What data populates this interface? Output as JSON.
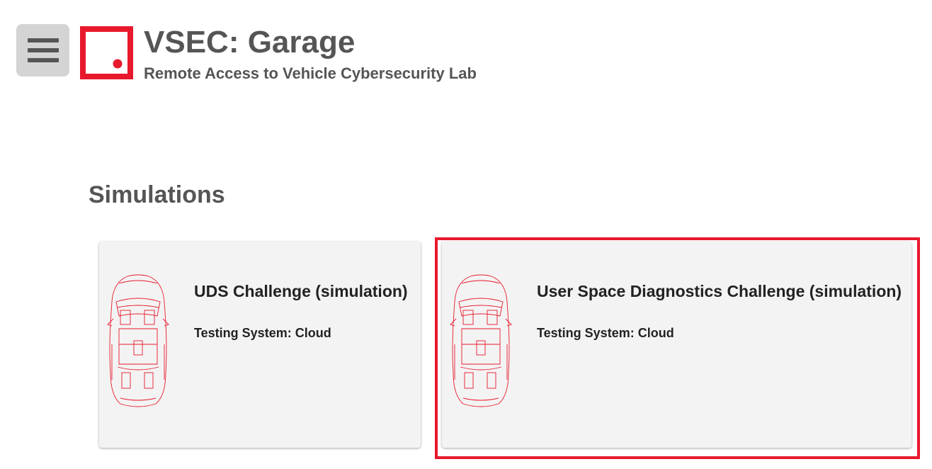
{
  "header": {
    "menu_icon": "hamburger-menu-icon",
    "logo_icon": "vsec-logo-icon",
    "title": "VSEC: Garage",
    "subtitle": "Remote Access to Vehicle Cybersecurity Lab"
  },
  "section": {
    "title": "Simulations"
  },
  "cards": [
    {
      "icon": "car-top-view-icon",
      "title": "UDS Challenge (simulation)",
      "system": "Testing System: Cloud"
    },
    {
      "icon": "car-top-view-icon",
      "title": "User Space Diagnostics Challenge (simulation)",
      "system": "Testing System: Cloud",
      "highlighted": true
    }
  ],
  "colors": {
    "accent": "#e8192c",
    "text": "#555555",
    "card_bg": "#f3f3f3",
    "menu_bg": "#d4d4d4"
  }
}
